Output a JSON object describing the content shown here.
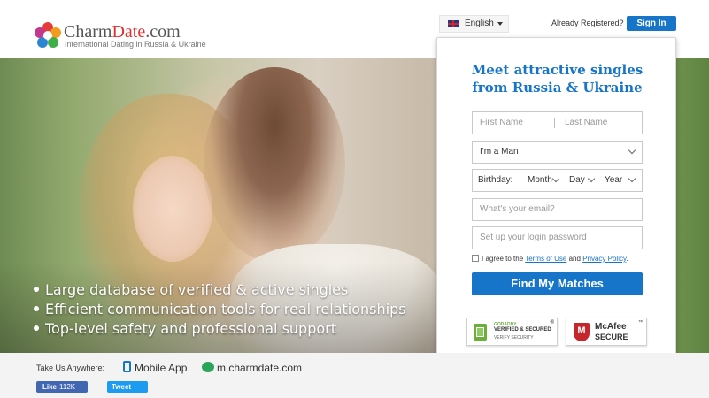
{
  "header": {
    "brand_part1": "Charm",
    "brand_part2": "Date",
    "brand_part3": ".com",
    "tagline": "International Dating in Russia & Ukraine",
    "language": "English",
    "already_registered": "Already Registered?",
    "signin_label": "Sign In"
  },
  "hero": {
    "bullets": [
      "Large database of verified & active singles",
      "Efficient communication tools for real relationships",
      "Top-level safety and professional support"
    ]
  },
  "signup": {
    "title_line1": "Meet attractive singles",
    "title_line2": "from Russia & Ukraine",
    "first_name_placeholder": "First Name",
    "last_name_placeholder": "Last Name",
    "gender_value": "I'm a Man",
    "birthday_label": "Birthday:",
    "month_label": "Month",
    "day_label": "Day",
    "year_label": "Year",
    "email_placeholder": "What's your email?",
    "password_placeholder": "Set up your login password",
    "agree_prefix": "I agree to the",
    "terms_link": "Terms of Use",
    "agree_and": "and",
    "privacy_link": "Privacy Policy",
    "agree_suffix": ".",
    "cta_label": "Find My Matches"
  },
  "badges": {
    "godaddy_line1": "GODADDY",
    "godaddy_line2": "VERIFIED & SECURED",
    "godaddy_line3": "VERIFY SECURITY",
    "godaddy_reg": "®",
    "mcafee_letter": "M",
    "mcafee_line1": "McAfee",
    "mcafee_line2": "SECURE",
    "mcafee_tm": "™"
  },
  "footer": {
    "take_us": "Take Us Anywhere:",
    "mobile_app": "Mobile App",
    "mobile_site": "m.charmdate.com",
    "like_label": "Like",
    "like_count": "112K",
    "tweet_label": "Tweet"
  },
  "colors": {
    "accent_blue": "#1674c9",
    "brand_red": "#e0302e",
    "facebook_blue": "#4267b2",
    "twitter_blue": "#1d9bf0"
  }
}
